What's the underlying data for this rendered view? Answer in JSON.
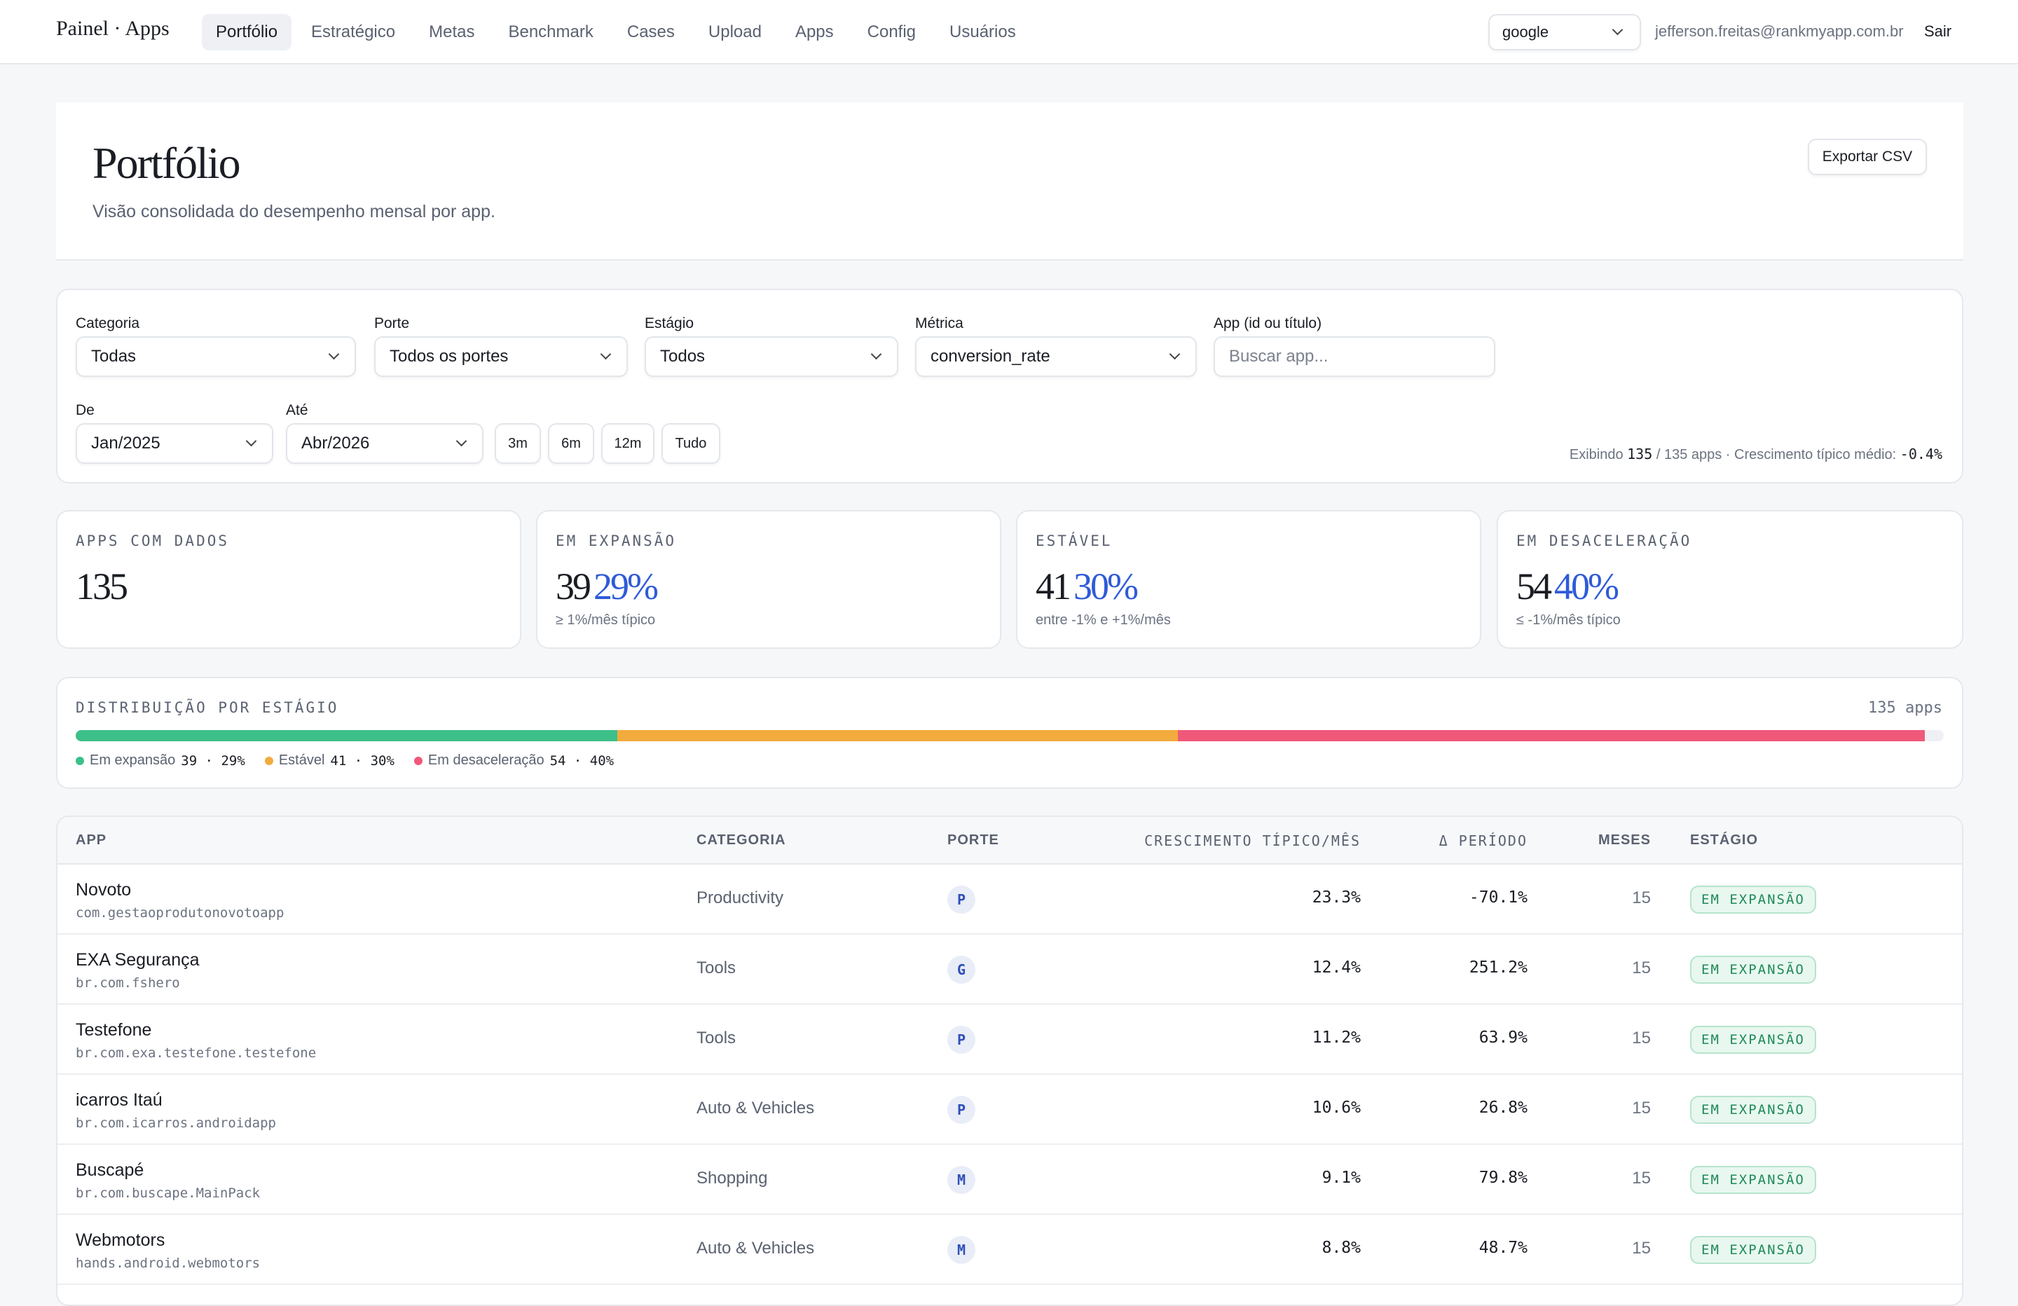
{
  "nav": {
    "brand": "Painel · Apps",
    "links": [
      "Portfólio",
      "Estratégico",
      "Metas",
      "Benchmark",
      "Cases",
      "Upload",
      "Apps",
      "Config",
      "Usuários"
    ],
    "env_selected": "google",
    "user_email": "jefferson.freitas@rankmyapp.com.br",
    "logout_label": "Sair"
  },
  "header": {
    "title": "Portfólio",
    "subtitle": "Visão consolidada do desempenho mensal por app.",
    "export_label": "Exportar CSV"
  },
  "filters": {
    "categoria": {
      "label": "Categoria",
      "value": "Todas"
    },
    "porte": {
      "label": "Porte",
      "value": "Todos os portes"
    },
    "estagio": {
      "label": "Estágio",
      "value": "Todos"
    },
    "metrica": {
      "label": "Métrica",
      "value": "conversion_rate"
    },
    "app": {
      "label": "App (id ou título)",
      "placeholder": "Buscar app..."
    },
    "de": {
      "label": "De",
      "value": "Jan/2025"
    },
    "ate": {
      "label": "Até",
      "value": "Abr/2026"
    },
    "ranges": [
      "3m",
      "6m",
      "12m",
      "Tudo"
    ],
    "summary": {
      "prefix": "Exibindo",
      "shown": "135",
      "sep": "/ 135 apps · Crescimento típico médio:",
      "avg": "-0.4%"
    }
  },
  "stats": [
    {
      "label": "APPS COM DADOS",
      "value": "135",
      "pct": "",
      "note": ""
    },
    {
      "label": "EM EXPANSÃO",
      "value": "39",
      "pct": "29%",
      "note": "≥ 1%/mês típico"
    },
    {
      "label": "ESTÁVEL",
      "value": "41",
      "pct": "30%",
      "note": "entre -1% e +1%/mês"
    },
    {
      "label": "EM DESACELERAÇÃO",
      "value": "54",
      "pct": "40%",
      "note": "≤ -1%/mês típico"
    }
  ],
  "distribution": {
    "title": "DISTRIBUIÇÃO POR ESTÁGIO",
    "total_label": "135 apps",
    "segments": [
      {
        "label": "Em expansão",
        "count": 39,
        "pct": 0.29,
        "display": "39 · 29%",
        "color": "#3dbf8a"
      },
      {
        "label": "Estável",
        "count": 41,
        "pct": 0.3,
        "display": "41 · 30%",
        "color": "#f2ab3c"
      },
      {
        "label": "Em desaceleração",
        "count": 54,
        "pct": 0.4,
        "display": "54 · 40%",
        "color": "#f0587a"
      }
    ]
  },
  "table": {
    "headers": {
      "app": "APP",
      "categoria": "CATEGORIA",
      "porte": "PORTE",
      "crescimento": "CRESCIMENTO TÍPICO/MÊS",
      "delta": "Δ PERÍODO",
      "meses": "MESES",
      "estagio": "ESTÁGIO"
    },
    "rows": [
      {
        "name": "Novoto",
        "id": "com.gestaoprodutonovotoapp",
        "categoria": "Productivity",
        "porte": "P",
        "crescimento": "23.3%",
        "delta": "-70.1%",
        "meses": "15",
        "estagio": "EM EXPANSÃO"
      },
      {
        "name": "EXA Segurança",
        "id": "br.com.fshero",
        "categoria": "Tools",
        "porte": "G",
        "crescimento": "12.4%",
        "delta": "251.2%",
        "meses": "15",
        "estagio": "EM EXPANSÃO"
      },
      {
        "name": "Testefone",
        "id": "br.com.exa.testefone.testefone",
        "categoria": "Tools",
        "porte": "P",
        "crescimento": "11.2%",
        "delta": "63.9%",
        "meses": "15",
        "estagio": "EM EXPANSÃO"
      },
      {
        "name": "icarros Itaú",
        "id": "br.com.icarros.androidapp",
        "categoria": "Auto & Vehicles",
        "porte": "P",
        "crescimento": "10.6%",
        "delta": "26.8%",
        "meses": "15",
        "estagio": "EM EXPANSÃO"
      },
      {
        "name": "Buscapé",
        "id": "br.com.buscape.MainPack",
        "categoria": "Shopping",
        "porte": "M",
        "crescimento": "9.1%",
        "delta": "79.8%",
        "meses": "15",
        "estagio": "EM EXPANSÃO"
      },
      {
        "name": "Webmotors",
        "id": "hands.android.webmotors",
        "categoria": "Auto & Vehicles",
        "porte": "M",
        "crescimento": "8.8%",
        "delta": "48.7%",
        "meses": "15",
        "estagio": "EM EXPANSÃO"
      }
    ]
  }
}
